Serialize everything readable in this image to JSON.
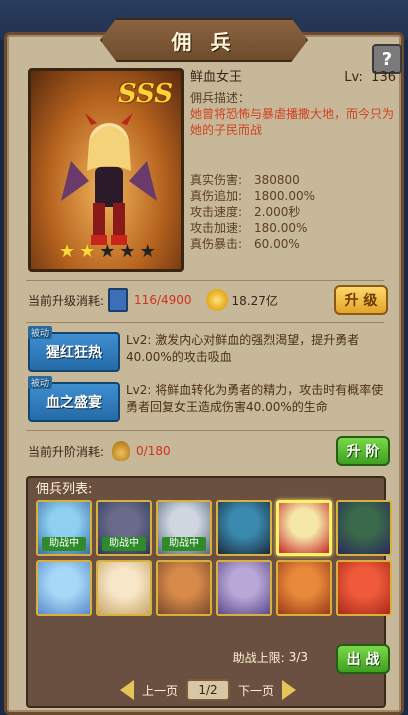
{
  "header": {
    "title": "佣 兵",
    "help_label": "?"
  },
  "hero": {
    "rank": "SSS",
    "name": "鲜血女王",
    "level_label": "Lv:",
    "level": "136",
    "desc_label": "佣兵描述：",
    "desc": "她曾将恐怖与暴虐播撒大地，而今只为她的子民而战",
    "stars_on": 2,
    "stars_total": 5,
    "stats": [
      {
        "k": "真实伤害:",
        "v": "380800"
      },
      {
        "k": "真伤追加:",
        "v": "1800.00%"
      },
      {
        "k": "攻击速度:",
        "v": "2.000秒"
      },
      {
        "k": "攻击加速:",
        "v": "180.00%"
      },
      {
        "k": "真伤暴击:",
        "v": "60.00%"
      }
    ]
  },
  "upgrade": {
    "label": "当前升级消耗:",
    "books": "116/4900",
    "gold": "18.27亿",
    "button": "升 级"
  },
  "skills": [
    {
      "tag": "被动",
      "name": "猩红狂热",
      "desc": "Lv2:  激发内心对鲜血的强烈渴望，提升勇者40.00%的攻击吸血"
    },
    {
      "tag": "被动",
      "name": "血之盛宴",
      "desc": "Lv2:  将鲜血转化为勇者的精力，攻击时有概率使勇者回复女王造成伤害40.00%的生命"
    }
  ],
  "promote": {
    "label": "当前升阶消耗:",
    "medals": "0/180",
    "button": "升 阶"
  },
  "roster": {
    "title": "佣兵列表:",
    "assist_tag": "助战中",
    "heroes": [
      {
        "name": "hero-1",
        "assist": true,
        "colors": [
          "#8fd0f0",
          "#3a6ea8"
        ]
      },
      {
        "name": "hero-2",
        "assist": true,
        "colors": [
          "#6a6a8a",
          "#2a3a5a"
        ]
      },
      {
        "name": "hero-3",
        "assist": true,
        "colors": [
          "#cfd6e0",
          "#5a6a7a"
        ]
      },
      {
        "name": "hero-4",
        "assist": false,
        "colors": [
          "#3a8ab0",
          "#1a2a3a"
        ]
      },
      {
        "name": "hero-5",
        "assist": false,
        "colors": [
          "#f6e6a8",
          "#c82a2a"
        ],
        "selected": true
      },
      {
        "name": "hero-6",
        "assist": false,
        "colors": [
          "#3a6a4a",
          "#2a2a5a"
        ]
      },
      {
        "name": "hero-7",
        "assist": false,
        "colors": [
          "#a8d8f8",
          "#5a8ac8"
        ]
      },
      {
        "name": "hero-8",
        "assist": false,
        "colors": [
          "#f8e6c8",
          "#c8a86a"
        ]
      },
      {
        "name": "hero-9",
        "assist": false,
        "colors": [
          "#d88a4a",
          "#7a4a2a"
        ]
      },
      {
        "name": "hero-10",
        "assist": false,
        "colors": [
          "#b8a8d8",
          "#5a4a8a"
        ]
      },
      {
        "name": "hero-11",
        "assist": false,
        "colors": [
          "#e88a3a",
          "#9a3a1a"
        ]
      },
      {
        "name": "hero-12",
        "assist": false,
        "colors": [
          "#f05a3a",
          "#a82a1a"
        ]
      }
    ],
    "assist_limit_label": "助战上限:",
    "assist_limit": "3/3",
    "deploy_button": "出 战",
    "prev_label": "上一页",
    "next_label": "下一页",
    "page": "1/2"
  }
}
